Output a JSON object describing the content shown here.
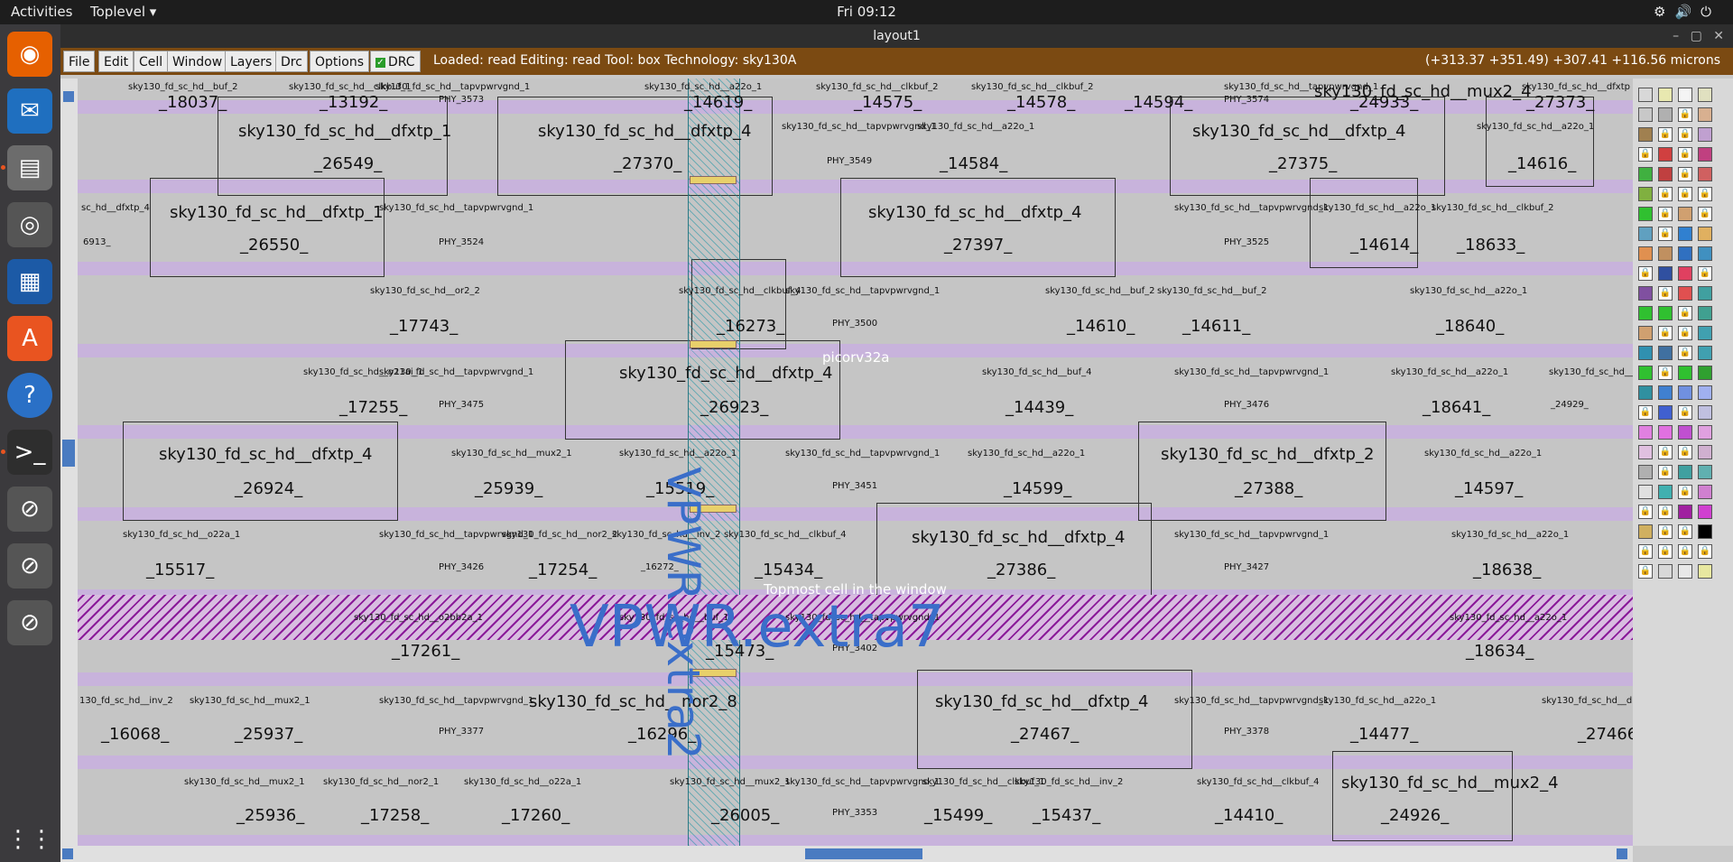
{
  "topbar": {
    "activities": "Activities",
    "app_menu": "Toplevel ▾",
    "clock": "Fri 09:12"
  },
  "window": {
    "title": "layout1"
  },
  "menu": {
    "file": "File",
    "edit": "Edit",
    "cell": "Cell",
    "window": "Window",
    "layers": "Layers",
    "drc": "Drc",
    "options": "Options",
    "drc_toggle": "DRC"
  },
  "status": {
    "text": "Loaded: read  Editing: read  Tool: box   Technology: sky130A",
    "coords": "(+313.37 +351.49) +307.41 +116.56 microns"
  },
  "layout": {
    "labels": {
      "picorv32a": "picorv32a",
      "topmost": "Topmost cell in the window",
      "vpwr_extra7": "VPWR.extra7",
      "vpwr_extra2": "VPWR.extra2"
    }
  }
}
